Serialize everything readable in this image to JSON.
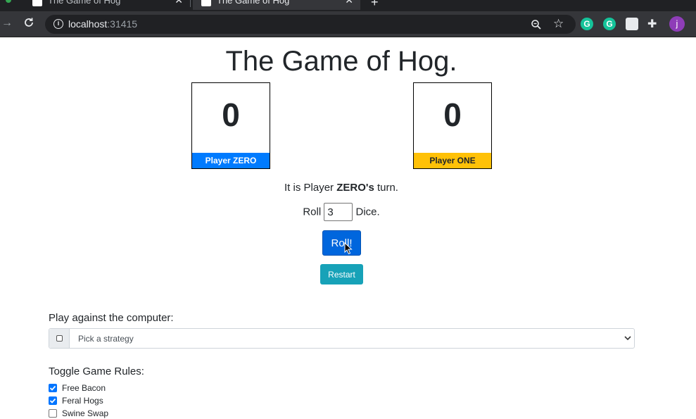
{
  "browser": {
    "tabs": [
      {
        "title": "The Game of Hog",
        "active": false
      },
      {
        "title": "The Game of Hog",
        "active": true
      }
    ],
    "url_host": "localhost",
    "url_port": ":31415",
    "avatar_letter": "j"
  },
  "game": {
    "title_light": "The Game of ",
    "title_bold": "Hog.",
    "players": [
      {
        "score": "0",
        "label": "Player ZERO",
        "color": "#007bff"
      },
      {
        "score": "0",
        "label": "Player ONE",
        "color": "#ffc107"
      }
    ],
    "turn_prefix": "It is Player ",
    "turn_player": "ZERO's",
    "turn_suffix": " turn.",
    "roll_prefix": "Roll",
    "dice_value": "3",
    "roll_suffix": "Dice.",
    "roll_button": "Roll!",
    "restart_button": "Restart"
  },
  "computer": {
    "label": "Play against the computer:",
    "strategy_placeholder": "Pick a strategy",
    "enabled": false
  },
  "rules": {
    "label": "Toggle Game Rules:",
    "items": [
      {
        "label": "Free Bacon",
        "checked": true
      },
      {
        "label": "Feral Hogs",
        "checked": true
      },
      {
        "label": "Swine Swap",
        "checked": false
      }
    ]
  }
}
